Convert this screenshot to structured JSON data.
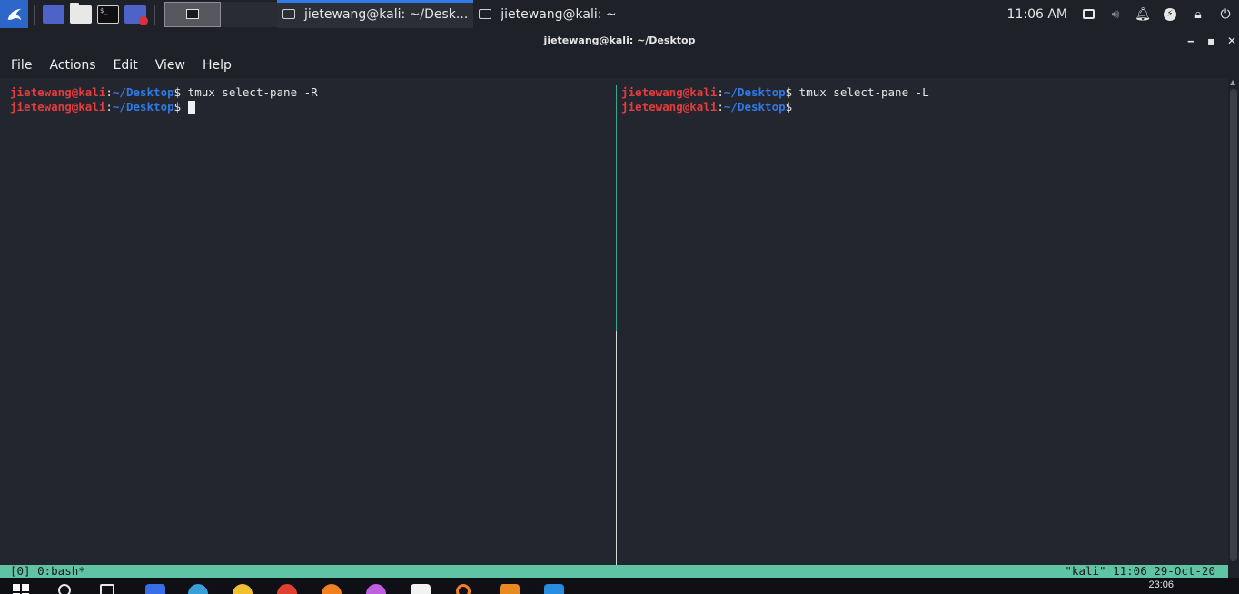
{
  "panel": {
    "tasks": [
      {
        "label": "jietewang@kali: ~/Desk...",
        "active": true
      },
      {
        "label": "jietewang@kali: ~",
        "active": false
      }
    ],
    "clock": "11:06 AM"
  },
  "window": {
    "title": "jietewang@kali: ~/Desktop"
  },
  "menu": [
    "File",
    "Actions",
    "Edit",
    "View",
    "Help"
  ],
  "panes": {
    "left": [
      {
        "user": "jietewang@kali",
        "colon": ":",
        "path": "~/Desktop",
        "dollar": "$",
        "cmd": " tmux select-pane -R"
      },
      {
        "user": "jietewang@kali",
        "colon": ":",
        "path": "~/Desktop",
        "dollar": "$",
        "cmd": ""
      }
    ],
    "right": [
      {
        "user": "jietewang@kali",
        "colon": ":",
        "path": "~/Desktop",
        "dollar": "$",
        "cmd": " tmux select-pane -L"
      },
      {
        "user": "jietewang@kali",
        "colon": ":",
        "path": "~/Desktop",
        "dollar": "$",
        "cmd": ""
      }
    ]
  },
  "tmux": {
    "left": "[0] 0:bash*",
    "right": "\"kali\" 11:06 29-Oct-20"
  },
  "windows_taskbar": {
    "time": "23:06"
  },
  "colors": {
    "prompt_user": "#e23c3c",
    "prompt_path": "#2f7ae5",
    "tmux_status": "#5ec4a4",
    "panel_accent": "#2f7ae5"
  }
}
